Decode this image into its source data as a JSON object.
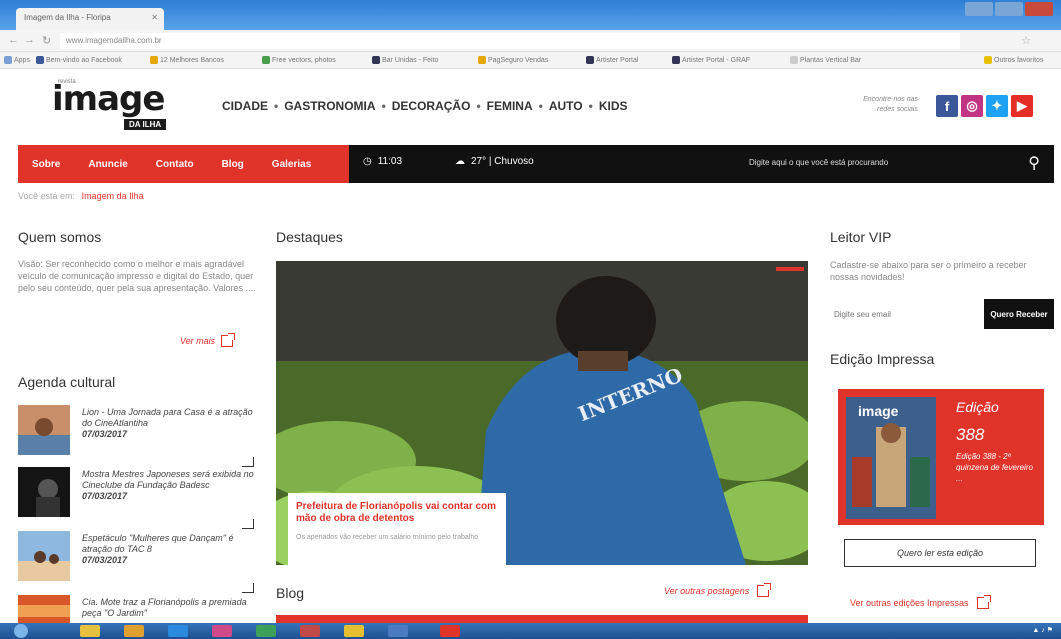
{
  "browser": {
    "tab_title": "Imagem da Ilha - Floripa",
    "url": "www.imagemdailha.com.br",
    "bookmarks": [
      "Apps",
      "Bem-vindo ao Facebook",
      "12 Melhores Bancos",
      "Free vectors, photos",
      "Bar Unidas - Feito",
      "PagSeguro Vendas",
      "Artister Portal",
      "Artister Portal - GRAF",
      "Plantas Vertical Bar",
      "Outros favoritos"
    ]
  },
  "header": {
    "logo_small": "revista",
    "logo_text": "image",
    "logo_badge": "DA ILHA",
    "nav": [
      "CIDADE",
      "GASTRONOMIA",
      "DECORAÇÃO",
      "FEMINA",
      "AUTO",
      "KIDS"
    ],
    "nav_separator": "•",
    "social_text": "Encontre-nos nas redes sociais",
    "social_icons": [
      "facebook-icon",
      "instagram-icon",
      "twitter-icon",
      "youtube-icon"
    ]
  },
  "menubar": {
    "links": [
      "Sobre",
      "Anuncie",
      "Contato",
      "Blog",
      "Galerias"
    ],
    "time": "11:03",
    "weather": "27° | Chuvoso",
    "search_placeholder": "Digite aqui o que você está procurando"
  },
  "breadcrumb": {
    "prefix": "Você está em:",
    "current": "Imagem da Ilha"
  },
  "about": {
    "title": "Quem somos",
    "text": "Visão: Ser reconhecido como o melhor e mais agradável veículo de comunicação impresso e digital do Estado, quer pelo seu conteúdo, quer pela sua apresentação. Valores ....",
    "more": "Ver mais"
  },
  "agenda": {
    "title": "Agenda cultural",
    "items": [
      {
        "text": "Lion - Uma Jornada para Casa é a atração do CineAtlantiha",
        "date": "07/03/2017"
      },
      {
        "text": "Mostra Mestres Japoneses será exibida no Cineclube da Fundação Badesc",
        "date": "07/03/2017"
      },
      {
        "text": "Espetáculo \"Mulheres que Dançam\" é atração do TAC 8",
        "date": "07/03/2017"
      },
      {
        "text": "Cia. Mote traz a Florianópolis a premiada peça \"O Jardim\"",
        "date": ""
      }
    ]
  },
  "destaques": {
    "title": "Destaques",
    "caption_title": "Prefeitura de Florianópolis vai contar com mão de obra de detentos",
    "caption_sub": "Os apenados vão receber um salário mínimo pelo trabalho",
    "shirt_text": "INTERNO"
  },
  "blog": {
    "title": "Blog",
    "more": "Ver outras postagens"
  },
  "vip": {
    "title": "Leitor VIP",
    "text": "Cadastre-se abaixo para ser o primeiro a receber nossas novidades!",
    "placeholder": "Digite seu email",
    "button": "Quero Receber"
  },
  "edicao": {
    "title": "Edição Impressa",
    "cover_title": "image",
    "label": "Edição",
    "number": "388",
    "desc": "Edição 388 - 2ª quinzena de fevereiro ...",
    "read_button": "Quero ler esta edição",
    "more": "Ver outras edições Impressas"
  },
  "colors": {
    "brand_red": "#e0332a",
    "dark": "#111111",
    "facebook": "#3b5998",
    "instagram": "#c13584",
    "twitter": "#1da1f2",
    "youtube": "#e52d27"
  }
}
